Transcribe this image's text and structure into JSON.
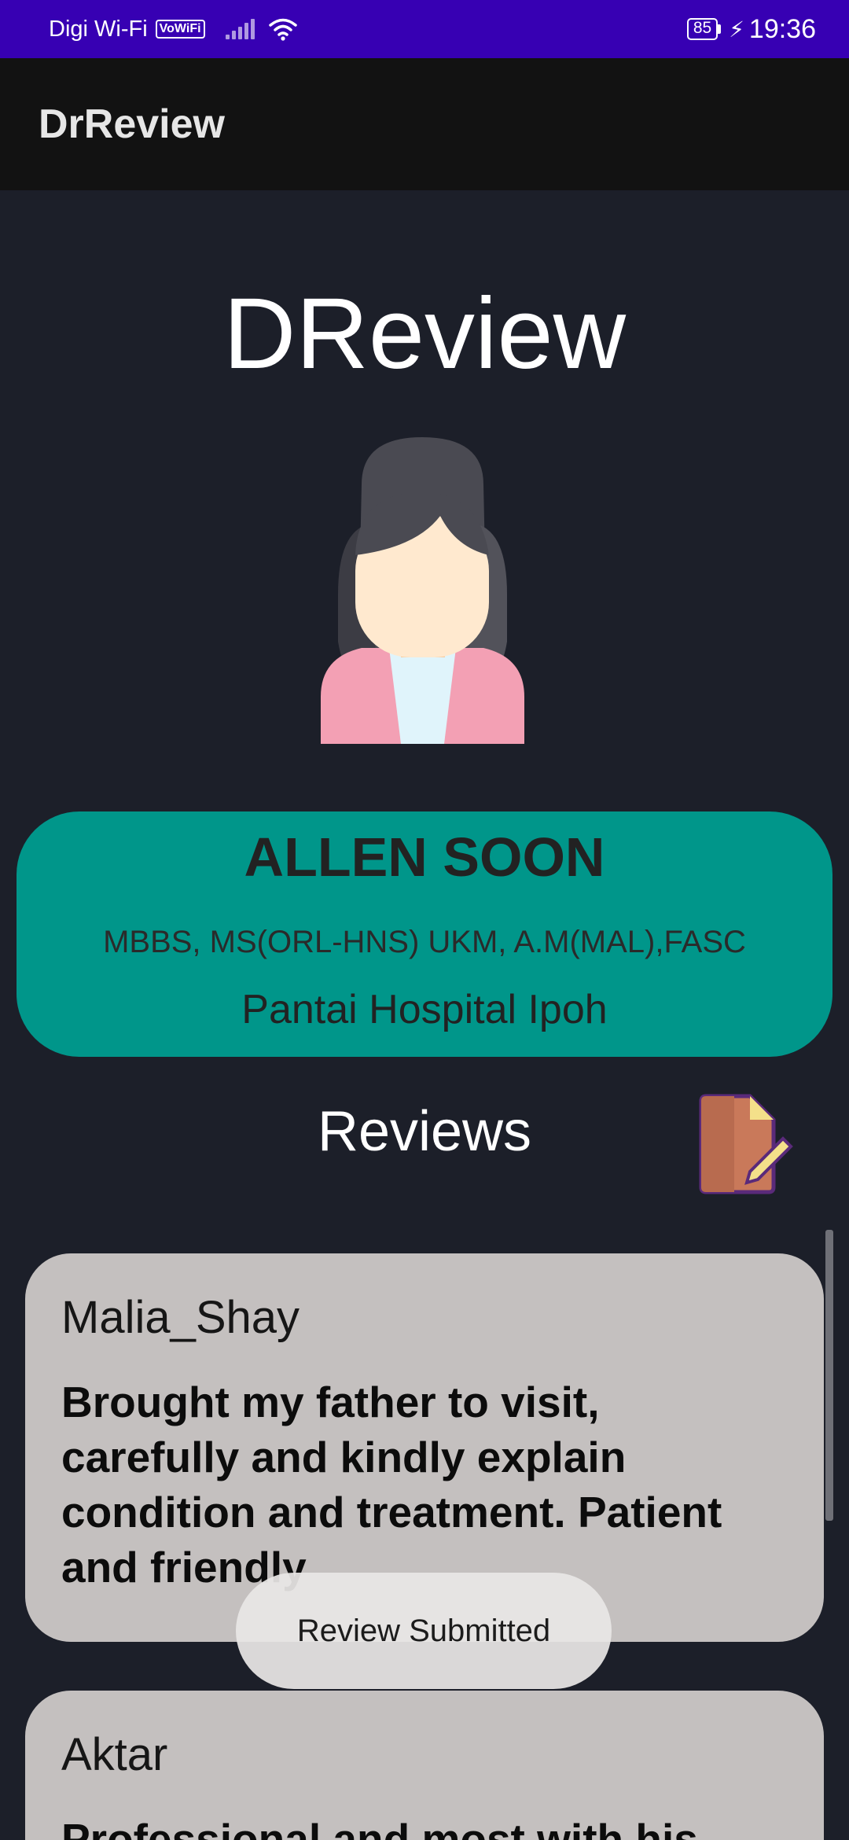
{
  "status_bar": {
    "carrier": "Digi Wi-Fi",
    "vowifi": "VoWiFi",
    "battery": "85",
    "time": "19:36",
    "icons": [
      "signal-icon",
      "wifi-icon",
      "battery-icon",
      "charging-icon"
    ]
  },
  "app_bar": {
    "title": "DrReview"
  },
  "brand": {
    "title": "DReview"
  },
  "doctor": {
    "name": "ALLEN SOON",
    "qualifications": "MBBS, MS(ORL-HNS) UKM, A.M(MAL),FASC",
    "hospital": "Pantai Hospital  Ipoh",
    "avatar_icon": "female-avatar-icon"
  },
  "reviews": {
    "title": "Reviews",
    "write_icon": "write-review-icon",
    "items": [
      {
        "user": "Malia_Shay",
        "text": "Brought my father to visit, carefully and kindly explain condition and treatment. Patient and friendly"
      },
      {
        "user": "Aktar",
        "text": "Professional and most with his"
      }
    ]
  },
  "toast": {
    "message": "Review Submitted"
  },
  "colors": {
    "status_bar": "#3700b3",
    "app_bar": "#121212",
    "background": "#1c1f29",
    "doctor_card": "#00968a",
    "review_card": "#c4c0bf"
  }
}
